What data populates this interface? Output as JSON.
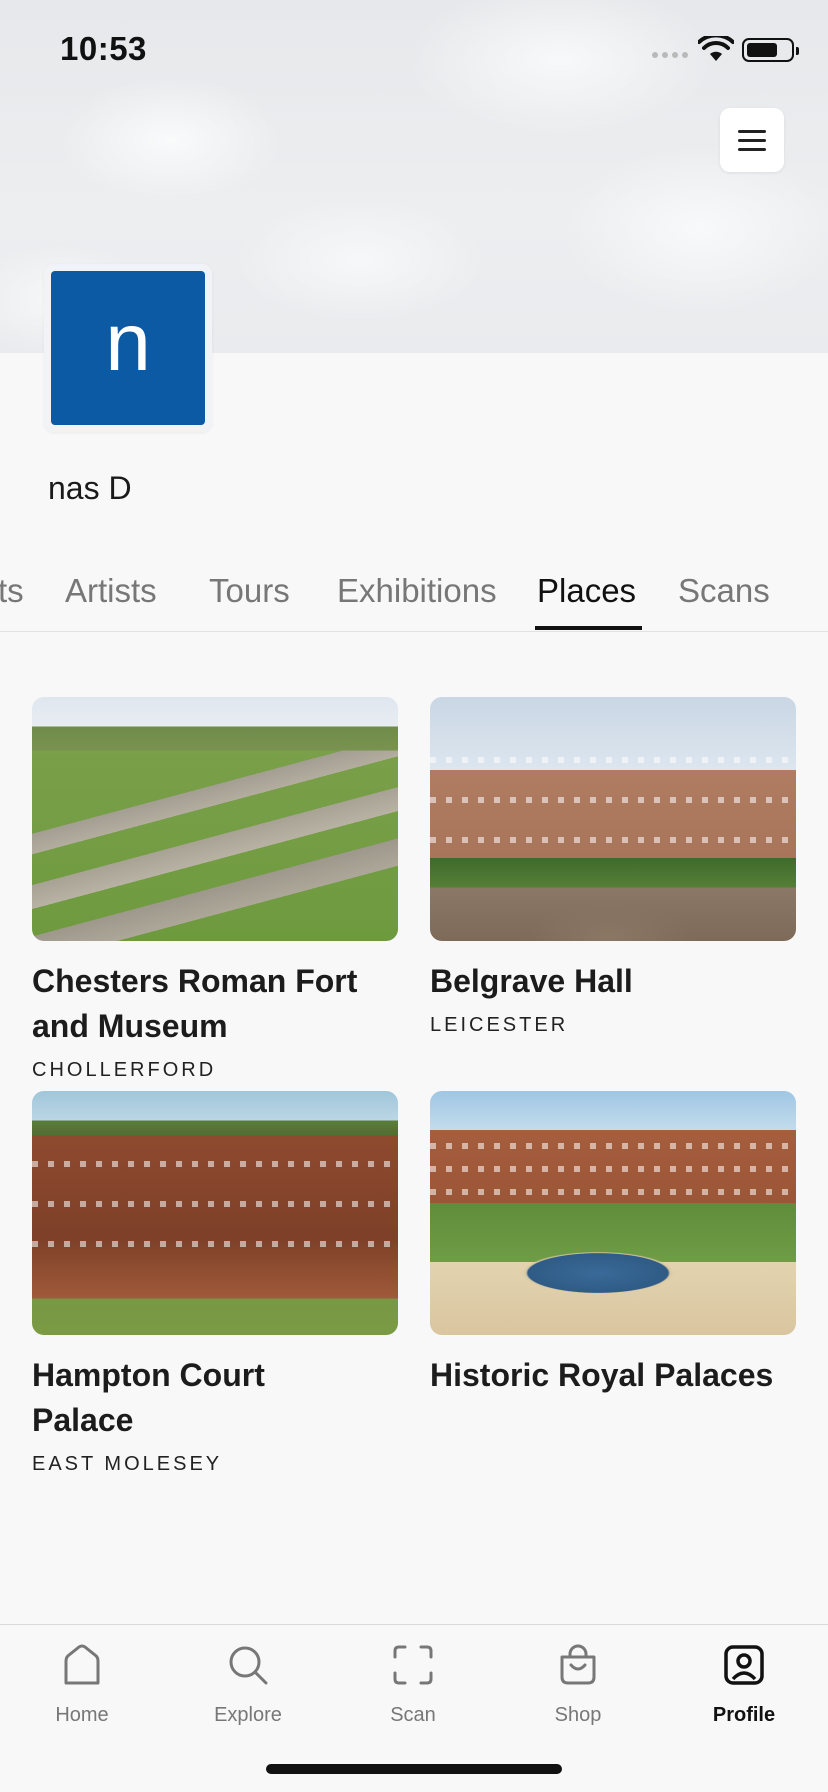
{
  "status_bar": {
    "time": "10:53"
  },
  "header": {
    "menu_icon": "hamburger-menu-icon",
    "avatar_initial": "n",
    "avatar_color": "#0b5aa3",
    "username": "nas D"
  },
  "tabs": {
    "items": [
      {
        "label": "ts"
      },
      {
        "label": "Artists"
      },
      {
        "label": "Tours"
      },
      {
        "label": "Exhibitions"
      },
      {
        "label": "Places"
      },
      {
        "label": "Scans"
      }
    ],
    "active": "Places"
  },
  "places": [
    {
      "title": "Chesters Roman Fort and Museum",
      "location": "CHOLLERFORD"
    },
    {
      "title": "Belgrave Hall",
      "location": "LEICESTER"
    },
    {
      "title": "Hampton Court Palace",
      "location": "EAST MOLESEY"
    },
    {
      "title": "Historic Royal Palaces",
      "location": ""
    }
  ],
  "bottom_nav": {
    "items": [
      {
        "label": "Home",
        "icon": "home-icon"
      },
      {
        "label": "Explore",
        "icon": "search-icon"
      },
      {
        "label": "Scan",
        "icon": "scan-icon"
      },
      {
        "label": "Shop",
        "icon": "shopping-bag-icon"
      },
      {
        "label": "Profile",
        "icon": "profile-icon"
      }
    ],
    "active": "Profile"
  }
}
